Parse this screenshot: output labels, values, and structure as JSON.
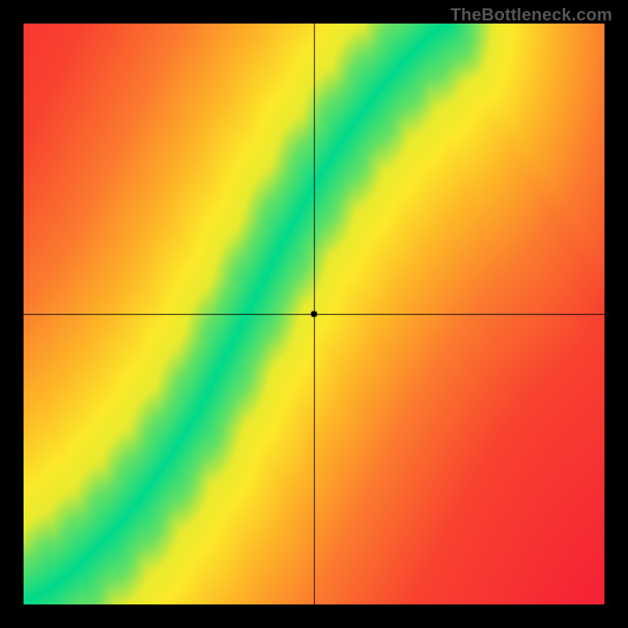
{
  "watermark": "TheBottleneck.com",
  "chart_data": {
    "type": "heatmap",
    "title": "",
    "xlabel": "",
    "ylabel": "",
    "xlim": [
      0,
      1
    ],
    "ylim": [
      0,
      1
    ],
    "grid": false,
    "legend": "none",
    "crosshair": {
      "x": 0.5,
      "y": 0.5
    },
    "marker": {
      "x": 0.5,
      "y": 0.5,
      "radius": 4,
      "color": "#000000"
    },
    "ideal_curve": {
      "description": "Green ridge: points lie along an S-shaped curve; colors range red→yellow→green by closeness to this curve",
      "points": [
        {
          "x": 0.0,
          "y": 0.0
        },
        {
          "x": 0.05,
          "y": 0.03
        },
        {
          "x": 0.1,
          "y": 0.07
        },
        {
          "x": 0.15,
          "y": 0.12
        },
        {
          "x": 0.2,
          "y": 0.18
        },
        {
          "x": 0.25,
          "y": 0.25
        },
        {
          "x": 0.3,
          "y": 0.33
        },
        {
          "x": 0.35,
          "y": 0.43
        },
        {
          "x": 0.4,
          "y": 0.53
        },
        {
          "x": 0.45,
          "y": 0.63
        },
        {
          "x": 0.5,
          "y": 0.72
        },
        {
          "x": 0.55,
          "y": 0.8
        },
        {
          "x": 0.6,
          "y": 0.87
        },
        {
          "x": 0.65,
          "y": 0.93
        },
        {
          "x": 0.7,
          "y": 0.98
        },
        {
          "x": 0.73,
          "y": 1.0
        }
      ]
    },
    "band_half_width": 0.045,
    "color_stops": [
      {
        "d": 0.0,
        "color": "#00D98B"
      },
      {
        "d": 0.05,
        "color": "#7FE25A"
      },
      {
        "d": 0.09,
        "color": "#E8EA2F"
      },
      {
        "d": 0.14,
        "color": "#FCE92A"
      },
      {
        "d": 0.25,
        "color": "#FDB627"
      },
      {
        "d": 0.4,
        "color": "#FB7A2E"
      },
      {
        "d": 0.6,
        "color": "#F8422F"
      },
      {
        "d": 1.0,
        "color": "#F51E36"
      }
    ]
  }
}
